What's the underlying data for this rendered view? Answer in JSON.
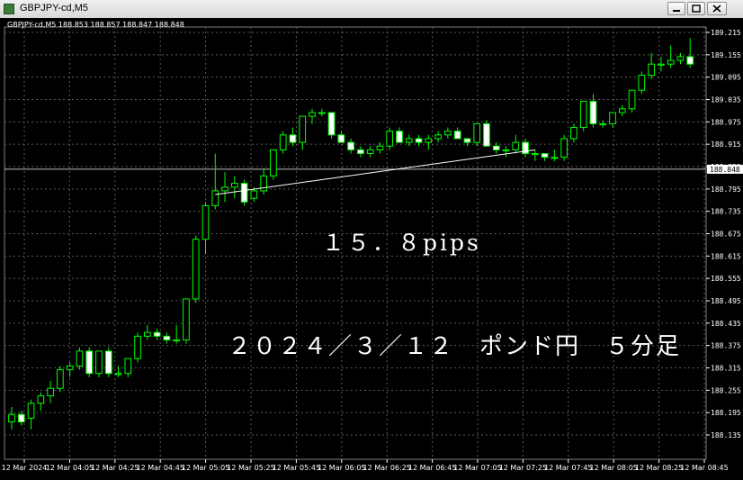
{
  "window": {
    "title": "GBPJPY-cd,M5",
    "buttons": [
      "minimize",
      "restore",
      "close"
    ]
  },
  "symbol_info": "GBPJPY-cd,M5  188.853 188.857 188.847 188.848",
  "current_price_label": "188.848",
  "annotations": {
    "pips": "１５．８pips",
    "caption": "２０２４／３／１２　ポンド円　５分足"
  },
  "colors": {
    "background": "#000000",
    "grid": "#5a5a5a",
    "bull_body": "#000000",
    "bear_body": "#ffffff",
    "wick": "#00ff00",
    "text": "#ffffff"
  },
  "chart_data": {
    "type": "candlestick",
    "ylim": [
      188.12,
      189.23
    ],
    "y_ticks": [
      "189.215",
      "189.155",
      "189.095",
      "189.035",
      "188.975",
      "188.915",
      "188.855",
      "188.795",
      "188.735",
      "188.675",
      "188.615",
      "188.555",
      "188.495",
      "188.435",
      "188.375",
      "188.315",
      "188.255",
      "188.195",
      "188.135"
    ],
    "x_ticks": [
      "12 Mar 2024",
      "12 Mar 04:05",
      "12 Mar 04:25",
      "12 Mar 04:45",
      "12 Mar 05:05",
      "12 Mar 05:25",
      "12 Mar 05:45",
      "12 Mar 06:05",
      "12 Mar 06:25",
      "12 Mar 06:45",
      "12 Mar 07:05",
      "12 Mar 07:25",
      "12 Mar 07:45",
      "12 Mar 08:05",
      "12 Mar 08:25",
      "12 Mar 08:45"
    ],
    "ohlc": [
      [
        188.17,
        188.21,
        188.15,
        188.19
      ],
      [
        188.19,
        188.2,
        188.16,
        188.17
      ],
      [
        188.18,
        188.23,
        188.15,
        188.22
      ],
      [
        188.22,
        188.25,
        188.2,
        188.24
      ],
      [
        188.24,
        188.28,
        188.22,
        188.26
      ],
      [
        188.26,
        188.32,
        188.25,
        188.31
      ],
      [
        188.31,
        188.33,
        188.29,
        188.32
      ],
      [
        188.32,
        188.37,
        188.31,
        188.36
      ],
      [
        188.36,
        188.37,
        188.29,
        188.3
      ],
      [
        188.3,
        188.36,
        188.29,
        188.36
      ],
      [
        188.36,
        188.37,
        188.29,
        188.3
      ],
      [
        188.3,
        188.32,
        188.29,
        188.3
      ],
      [
        188.3,
        188.34,
        188.29,
        188.34
      ],
      [
        188.34,
        188.41,
        188.33,
        188.4
      ],
      [
        188.4,
        188.43,
        188.39,
        188.41
      ],
      [
        188.41,
        188.42,
        188.39,
        188.4
      ],
      [
        188.4,
        188.41,
        188.38,
        188.39
      ],
      [
        188.39,
        188.43,
        188.38,
        188.39
      ],
      [
        188.39,
        188.5,
        188.38,
        188.5
      ],
      [
        188.5,
        188.67,
        188.49,
        188.66
      ],
      [
        188.66,
        188.76,
        188.62,
        188.75
      ],
      [
        188.75,
        188.89,
        188.74,
        188.79
      ],
      [
        188.79,
        188.84,
        188.76,
        188.8
      ],
      [
        188.8,
        188.83,
        188.77,
        188.81
      ],
      [
        188.81,
        188.82,
        188.75,
        188.76
      ],
      [
        188.77,
        188.8,
        188.76,
        188.79
      ],
      [
        188.79,
        188.85,
        188.78,
        188.83
      ],
      [
        188.83,
        188.9,
        188.82,
        188.9
      ],
      [
        188.9,
        188.95,
        188.89,
        188.94
      ],
      [
        188.94,
        188.96,
        188.91,
        188.92
      ],
      [
        188.92,
        188.99,
        188.9,
        188.99
      ],
      [
        188.99,
        189.01,
        188.97,
        189.0
      ],
      [
        189.0,
        189.01,
        188.99,
        189.0
      ],
      [
        189.0,
        189.0,
        188.93,
        188.94
      ],
      [
        188.94,
        188.95,
        188.92,
        188.92
      ],
      [
        188.92,
        188.93,
        188.89,
        188.9
      ],
      [
        188.9,
        188.91,
        188.88,
        188.89
      ],
      [
        188.89,
        188.91,
        188.88,
        188.9
      ],
      [
        188.9,
        188.92,
        188.89,
        188.91
      ],
      [
        188.91,
        188.96,
        188.9,
        188.95
      ],
      [
        188.95,
        188.96,
        188.92,
        188.92
      ],
      [
        188.92,
        188.94,
        188.91,
        188.93
      ],
      [
        188.93,
        188.94,
        188.91,
        188.92
      ],
      [
        188.92,
        188.94,
        188.9,
        188.93
      ],
      [
        188.93,
        188.95,
        188.92,
        188.94
      ],
      [
        188.94,
        188.96,
        188.93,
        188.95
      ],
      [
        188.95,
        188.96,
        188.93,
        188.93
      ],
      [
        188.93,
        188.93,
        188.91,
        188.92
      ],
      [
        188.92,
        188.97,
        188.91,
        188.97
      ],
      [
        188.97,
        188.98,
        188.91,
        188.91
      ],
      [
        188.91,
        188.92,
        188.89,
        188.9
      ],
      [
        188.9,
        188.91,
        188.88,
        188.9
      ],
      [
        188.9,
        188.94,
        188.89,
        188.92
      ],
      [
        188.92,
        188.93,
        188.88,
        188.89
      ],
      [
        188.89,
        188.9,
        188.87,
        188.89
      ],
      [
        188.89,
        188.89,
        188.87,
        188.88
      ],
      [
        188.88,
        188.9,
        188.87,
        188.88
      ],
      [
        188.88,
        188.94,
        188.87,
        188.93
      ],
      [
        188.93,
        188.97,
        188.92,
        188.96
      ],
      [
        188.96,
        189.03,
        188.95,
        189.03
      ],
      [
        189.03,
        189.05,
        188.96,
        188.97
      ],
      [
        188.97,
        188.98,
        188.96,
        188.97
      ],
      [
        188.97,
        189.0,
        188.96,
        189.0
      ],
      [
        189.0,
        189.02,
        188.99,
        189.01
      ],
      [
        189.01,
        189.06,
        189.0,
        189.06
      ],
      [
        189.06,
        189.11,
        189.05,
        189.1
      ],
      [
        189.1,
        189.16,
        189.09,
        189.13
      ],
      [
        189.13,
        189.15,
        189.11,
        189.13
      ],
      [
        189.13,
        189.18,
        189.12,
        189.14
      ],
      [
        189.14,
        189.16,
        189.13,
        189.15
      ],
      [
        189.15,
        189.2,
        189.12,
        189.13
      ]
    ],
    "trendline": {
      "from": [
        188.78,
        21
      ],
      "to": [
        188.9,
        54
      ]
    },
    "current_price": 188.848
  }
}
